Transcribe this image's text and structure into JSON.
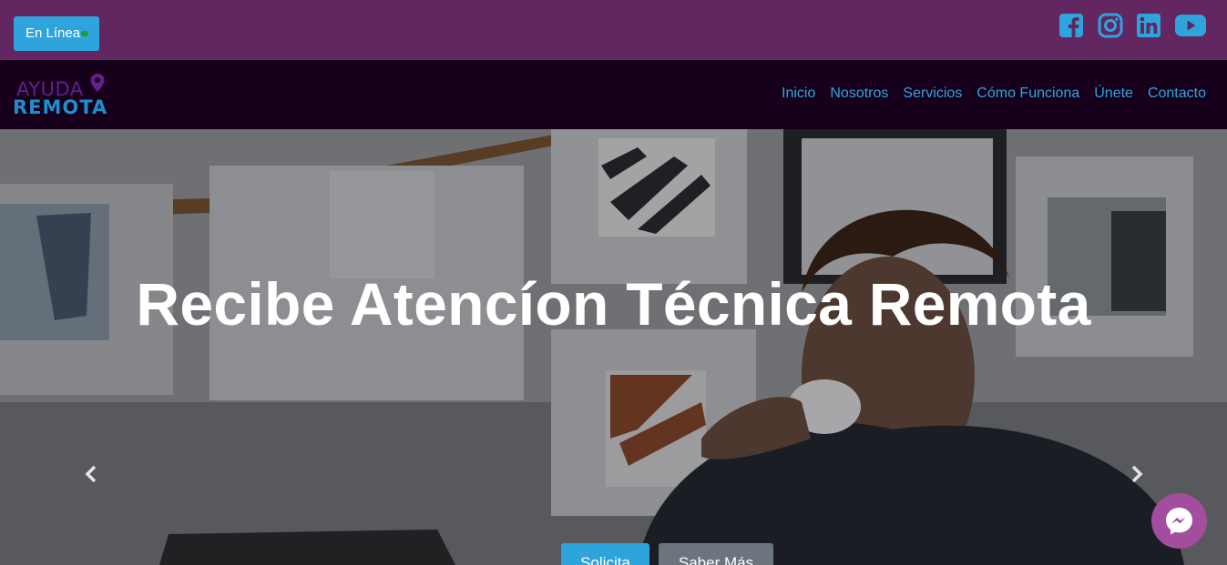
{
  "topbar": {
    "status_button": "En Línea",
    "social_icons": [
      "facebook-icon",
      "instagram-icon",
      "linkedin-icon",
      "youtube-icon"
    ]
  },
  "logo": {
    "line1": "AYUDA",
    "line2": "REMOTA"
  },
  "nav": {
    "items": [
      {
        "label": "Inicio"
      },
      {
        "label": "Nosotros"
      },
      {
        "label": "Servicios"
      },
      {
        "label": "Cómo Funciona"
      },
      {
        "label": "Únete"
      },
      {
        "label": "Contacto"
      }
    ]
  },
  "hero": {
    "title": "Recibe Atencíon Técnica Remota",
    "primary_button": "Solicita",
    "secondary_button": "Saber Más"
  },
  "colors": {
    "topbar_bg": "#622660",
    "navbar_bg": "#16001b",
    "accent_blue": "#2fa4dc",
    "status_dot": "#1f9c2e",
    "messenger_bg": "#a34d9f"
  }
}
